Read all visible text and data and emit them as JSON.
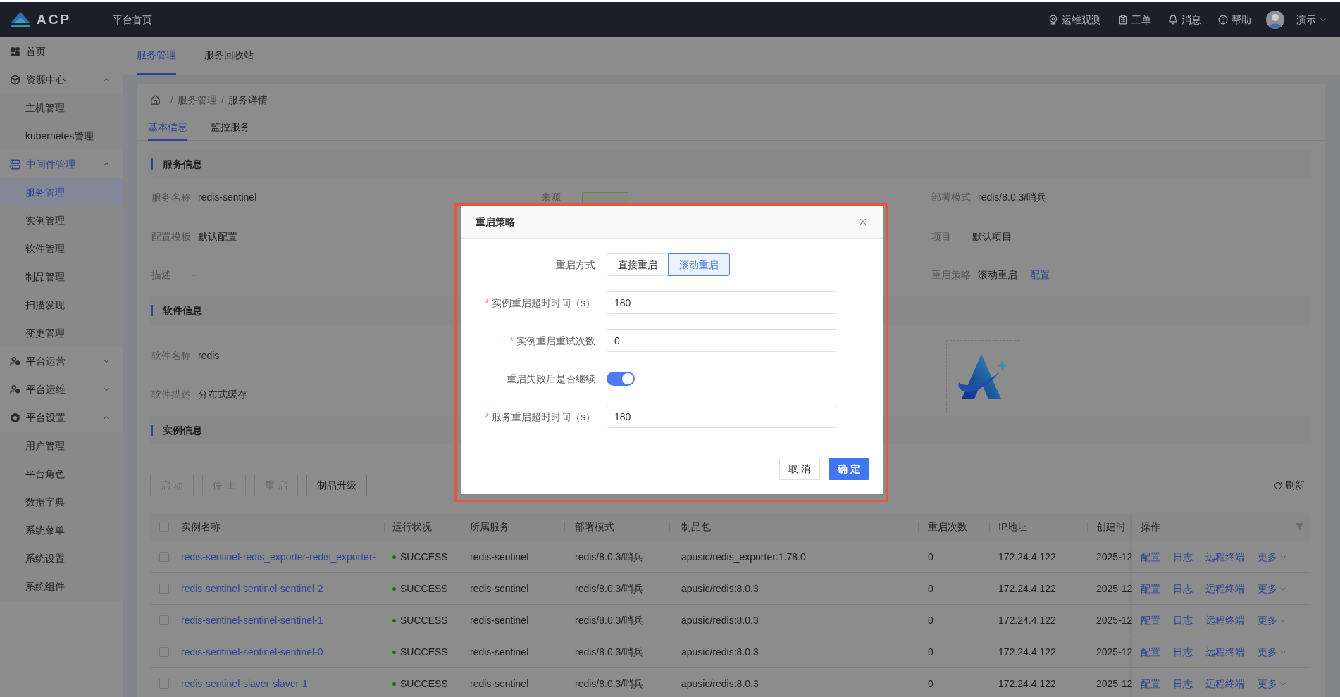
{
  "header": {
    "logo": "ACP",
    "home_link": "平台首页",
    "actions": [
      {
        "kind": "observe",
        "label": "运维观测"
      },
      {
        "kind": "ticket",
        "label": "工单"
      },
      {
        "kind": "bell",
        "label": "消息"
      },
      {
        "kind": "help",
        "label": "帮助"
      }
    ],
    "user": "演示"
  },
  "sidebar": {
    "items": [
      {
        "kind": "dashboard",
        "label": "首页",
        "selected": false
      },
      {
        "kind": "cube",
        "label": "资源中心",
        "expanded": true,
        "children": [
          {
            "label": "主机管理",
            "selected": false
          },
          {
            "label": "kubernetes管理",
            "selected": false
          }
        ]
      },
      {
        "kind": "server",
        "label": "中间件管理",
        "expanded": true,
        "children": [
          {
            "label": "服务管理",
            "selected": true
          },
          {
            "label": "实例管理",
            "selected": false
          },
          {
            "label": "软件管理",
            "selected": false
          },
          {
            "label": "制品管理",
            "selected": false
          },
          {
            "label": "扫描发现",
            "selected": false
          },
          {
            "label": "变更管理",
            "selected": false
          }
        ]
      },
      {
        "kind": "user",
        "label": "平台运营",
        "expanded": false
      },
      {
        "kind": "user",
        "label": "平台运维",
        "expanded": false
      },
      {
        "kind": "settings",
        "label": "平台设置",
        "expanded": true,
        "children": [
          {
            "label": "用户管理",
            "selected": false
          },
          {
            "label": "平台角色",
            "selected": false
          },
          {
            "label": "数据字典",
            "selected": false
          },
          {
            "label": "系统菜单",
            "selected": false
          },
          {
            "label": "系统设置",
            "selected": false
          },
          {
            "label": "系统组件",
            "selected": false
          }
        ]
      }
    ]
  },
  "tabs": [
    {
      "label": "服务管理",
      "selected": true
    },
    {
      "label": "服务回收站",
      "selected": false
    }
  ],
  "breadcrumb": [
    {
      "separator": "/",
      "label": "服务管理"
    },
    {
      "separator": "/",
      "label": "服务详情"
    }
  ],
  "detail_tabs": [
    {
      "label": "基本信息",
      "selected": true
    },
    {
      "label": "监控服务",
      "selected": false
    }
  ],
  "service_info": {
    "title": "服务信息",
    "rows": [
      [
        {
          "kind": "text",
          "label": "服务名称",
          "value": "redis-sentinel"
        },
        {
          "kind": "tag",
          "label": "来源"
        },
        {
          "kind": "text",
          "label": "部署模式",
          "value": "redis/8.0.3/哨兵"
        }
      ],
      [
        {
          "kind": "text",
          "label": "配置模板",
          "value": "默认配置"
        },
        null,
        {
          "kind": "text",
          "label": "项目",
          "value": "默认项目"
        }
      ],
      [
        {
          "kind": "text",
          "label": "描述",
          "value": "-"
        },
        null,
        {
          "kind": "text",
          "label": "重启策略",
          "value": "滚动重启",
          "link": "配置"
        }
      ]
    ]
  },
  "software_info": {
    "title": "软件信息",
    "fields": [
      {
        "label": "软件名称",
        "value": "redis"
      },
      {
        "label": "软件描述",
        "value": "分布式缓存"
      }
    ]
  },
  "instance_info": {
    "title": "实例信息",
    "buttons": [
      {
        "label": "启 动",
        "disabled": true
      },
      {
        "label": "停 止",
        "disabled": true
      },
      {
        "label": "重 启",
        "disabled": true
      },
      {
        "label": "制品升级",
        "disabled": false
      }
    ],
    "refresh": "刷新",
    "table": {
      "all_checked": false,
      "columns": [
        "实例名称",
        "运行状况",
        "所属服务",
        "部署模式",
        "制品包",
        "重启次数",
        "IP地址",
        "创建时",
        "操作"
      ],
      "rows": [
        {
          "checked": false,
          "name": "redis-sentinel-redis_exporter-redis_exporter-",
          "status": "SUCCESS",
          "service": "redis-sentinel",
          "mode": "redis/8.0.3/哨兵",
          "package": "apusic/redis_exporter:1.78.0",
          "restarts": "0",
          "ip": "172.24.4.122",
          "created": "2025-12",
          "actions": [
            {
              "kind": "link",
              "label": "配置"
            },
            {
              "kind": "link",
              "label": "日志"
            },
            {
              "kind": "link",
              "label": "远程终端"
            },
            {
              "kind": "dropdown",
              "label": "更多"
            }
          ]
        },
        {
          "checked": false,
          "name": "redis-sentinel-sentinel-sentinel-2",
          "status": "SUCCESS",
          "service": "redis-sentinel",
          "mode": "redis/8.0.3/哨兵",
          "package": "apusic/redis:8.0.3",
          "restarts": "0",
          "ip": "172.24.4.122",
          "created": "2025-12",
          "actions": [
            {
              "kind": "link",
              "label": "配置"
            },
            {
              "kind": "link",
              "label": "日志"
            },
            {
              "kind": "link",
              "label": "远程终端"
            },
            {
              "kind": "dropdown",
              "label": "更多"
            }
          ]
        },
        {
          "checked": false,
          "name": "redis-sentinel-sentinel-sentinel-1",
          "status": "SUCCESS",
          "service": "redis-sentinel",
          "mode": "redis/8.0.3/哨兵",
          "package": "apusic/redis:8.0.3",
          "restarts": "0",
          "ip": "172.24.4.122",
          "created": "2025-12",
          "actions": [
            {
              "kind": "link",
              "label": "配置"
            },
            {
              "kind": "link",
              "label": "日志"
            },
            {
              "kind": "link",
              "label": "远程终端"
            },
            {
              "kind": "dropdown",
              "label": "更多"
            }
          ]
        },
        {
          "checked": false,
          "name": "redis-sentinel-sentinel-sentinel-0",
          "status": "SUCCESS",
          "service": "redis-sentinel",
          "mode": "redis/8.0.3/哨兵",
          "package": "apusic/redis:8.0.3",
          "restarts": "0",
          "ip": "172.24.4.122",
          "created": "2025-12",
          "actions": [
            {
              "kind": "link",
              "label": "配置"
            },
            {
              "kind": "link",
              "label": "日志"
            },
            {
              "kind": "link",
              "label": "远程终端"
            },
            {
              "kind": "dropdown",
              "label": "更多"
            }
          ]
        },
        {
          "checked": false,
          "name": "redis-sentinel-slaver-slaver-1",
          "status": "SUCCESS",
          "service": "redis-sentinel",
          "mode": "redis/8.0.3/哨兵",
          "package": "apusic/redis:8.0.3",
          "restarts": "0",
          "ip": "172.24.4.122",
          "created": "2025-12",
          "actions": [
            {
              "kind": "link",
              "label": "配置"
            },
            {
              "kind": "link",
              "label": "日志"
            },
            {
              "kind": "link",
              "label": "远程终端"
            },
            {
              "kind": "dropdown",
              "label": "更多"
            }
          ]
        }
      ]
    }
  },
  "dialog": {
    "title": "重启策略",
    "fields": [
      {
        "kind": "segmented",
        "label": "重启方式",
        "options": [
          {
            "label": "直接重启",
            "selected": false
          },
          {
            "label": "滚动重启",
            "selected": true
          }
        ]
      },
      {
        "kind": "input",
        "label": "实例重启超时时间（s）",
        "required_mark": "*",
        "value": "180"
      },
      {
        "kind": "input",
        "label": "实例重启重试次数",
        "required_mark": "*",
        "value": "0"
      },
      {
        "kind": "switch",
        "label": "重启失败后是否继续",
        "on": true
      },
      {
        "kind": "input",
        "label": "服务重启超时时间（s）",
        "required_mark": "*",
        "value": "180"
      }
    ],
    "buttons": [
      {
        "kind": "secondary",
        "label": "取 消"
      },
      {
        "kind": "primary",
        "label": "确 定"
      }
    ]
  }
}
